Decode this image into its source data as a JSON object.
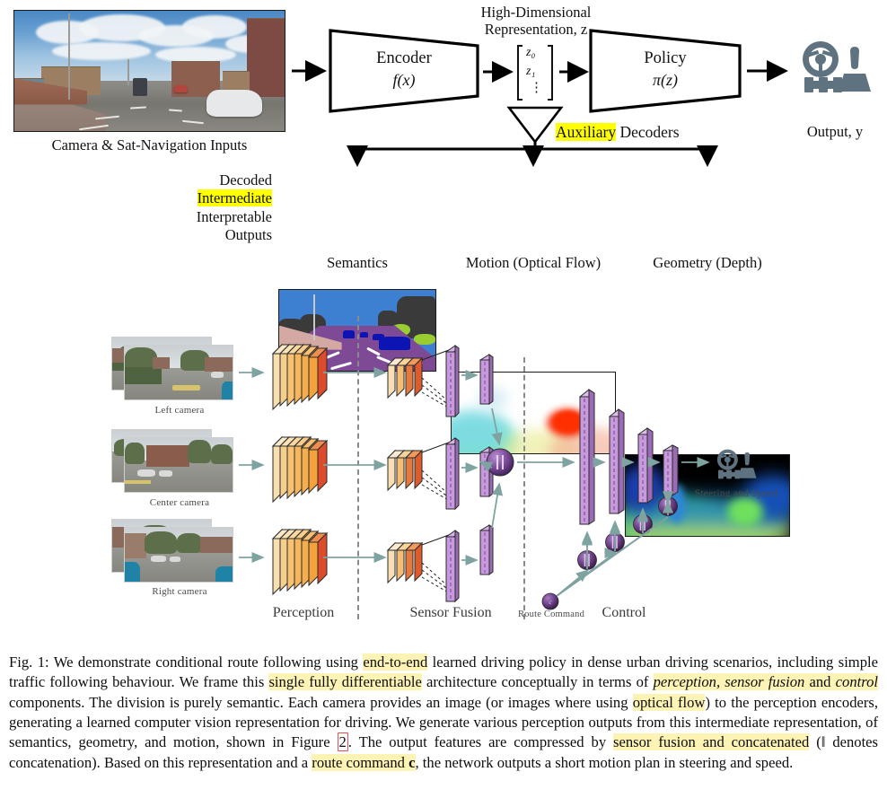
{
  "figure": {
    "top_diagram": {
      "input_image_caption": "Camera & Sat-Navigation Inputs",
      "encoder": {
        "title": "Encoder",
        "formula": "f(x)"
      },
      "latent": {
        "heading_line1": "High-Dimensional",
        "heading_line2": "Representation, z",
        "entries": [
          "z₀",
          "z₁",
          "⋮"
        ]
      },
      "policy": {
        "title": "Policy",
        "formula": "π(z)"
      },
      "output": {
        "label": "Output, y",
        "icon": "steering-wheel-gearshift-icon"
      },
      "decoders": {
        "highlight_word": "Auxiliary",
        "rest_word": " Decoders",
        "side_label_lines": [
          "Decoded",
          "Intermediate",
          "Interpretable",
          "Outputs"
        ],
        "side_label_highlighted_index": 1,
        "panels": [
          {
            "name": "semantics-panel",
            "caption": "Semantics"
          },
          {
            "name": "optical-flow-panel",
            "caption": "Motion (Optical Flow)"
          },
          {
            "name": "depth-panel",
            "caption": "Geometry (Depth)"
          }
        ]
      }
    },
    "bottom_diagram": {
      "cameras": [
        {
          "label": "Left camera"
        },
        {
          "label": "Center camera"
        },
        {
          "label": "Right camera"
        }
      ],
      "sections": [
        {
          "label": "Perception"
        },
        {
          "label": "Sensor Fusion"
        },
        {
          "label": "Control"
        }
      ],
      "route_command_label": "Route Command",
      "output_label": "Steering and Speed",
      "output_icon": "steering-wheel-gearshift-icon",
      "concat_symbol": "‖"
    },
    "caption": {
      "label": "Fig. 1:",
      "segments": [
        {
          "text": " We demonstrate conditional route following using ",
          "style": "plain"
        },
        {
          "text": "end-to-end",
          "style": "highlight"
        },
        {
          "text": " learned driving policy in dense urban driving scenarios, including simple traffic following behaviour. We frame this ",
          "style": "plain"
        },
        {
          "text": "single fully differentiable",
          "style": "highlight"
        },
        {
          "text": " architecture conceptually in terms of ",
          "style": "plain"
        },
        {
          "text": "perception, sensor fusion",
          "style": "highlight-italic"
        },
        {
          "text": " and ",
          "style": "highlight"
        },
        {
          "text": "control",
          "style": "highlight-italic"
        },
        {
          "text": " components. The division is purely semantic. Each camera provides an image (or images where using ",
          "style": "plain"
        },
        {
          "text": "optical flow",
          "style": "highlight"
        },
        {
          "text": ") to the perception encoders, generating a learned computer vision representation for driving. We generate various perception outputs from this intermediate representation, of semantics, geometry, and motion, shown in Figure ",
          "style": "plain"
        },
        {
          "text": "2",
          "style": "figref"
        },
        {
          "text": ". The output features are compressed by ",
          "style": "plain"
        },
        {
          "text": "sensor fusion and concatenated",
          "style": "highlight"
        },
        {
          "text": " (‖ denotes concatenation). Based on this representation and a ",
          "style": "plain"
        },
        {
          "text": "route command c",
          "style": "highlight-boldend"
        },
        {
          "text": ", the network outputs a short motion plan in steering and speed.",
          "style": "plain"
        }
      ],
      "full_text": "Fig. 1: We demonstrate conditional route following using an end-to-end learned driving policy in dense urban driving scenarios, including simple traffic following behaviour. We frame this single fully differentiable architecture conceptually in terms of perception, sensor fusion and control components. The division is purely semantic. Each camera provides an image (or images where using optical flow) to the perception encoders, generating a learned computer vision representation for driving. We generate various perception outputs from this intermediate representation, of semantics, geometry, and motion, shown in Figure 2. The output features are compressed by sensor fusion and concatenated (|| denotes concatenation). Based on this representation and a route command c, the network outputs a short motion plan in steering and speed."
    }
  },
  "colors": {
    "highlight_strong": "#ffff00",
    "highlight_soft": "#fdf3b5",
    "icon_gray_blue": "#5f7280",
    "arrow_teal": "#7fa3a0",
    "encoder_orange": "#f5b75e",
    "encoder_red": "#dc4b2a",
    "fusion_purple": "#b07fc7",
    "sphere_purple": "#6b3f86",
    "divider_gray": "#8a8a8a",
    "figref_box": "#e2504f"
  }
}
